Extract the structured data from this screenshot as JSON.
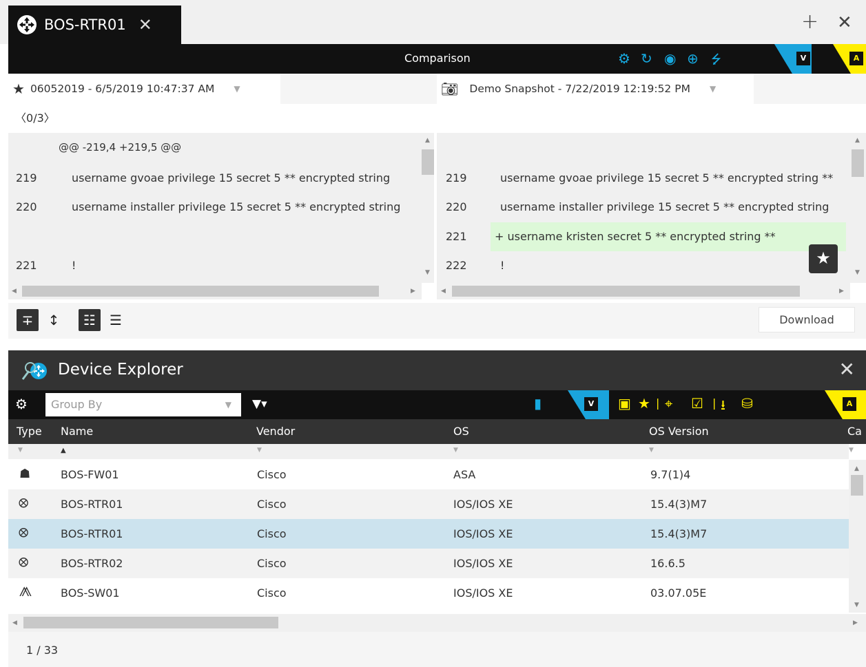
{
  "tab": {
    "title": "BOS-RTR01",
    "close": "✕"
  },
  "window": {
    "add": "+",
    "close": "✕"
  },
  "comparison": {
    "title": "Comparison",
    "left_snapshot": "06052019 - 6/5/2019 10:47:37 AM",
    "right_snapshot": "Demo Snapshot - 7/22/2019 12:19:52 PM",
    "nav": {
      "prev": "〈",
      "counter": "0/3",
      "next": "〉"
    },
    "hunk_header": "@@ -219,4 +219,5 @@",
    "left_lines": [
      {
        "num": "219",
        "text": "username gvoae privilege 15 secret 5 ** encrypted string"
      },
      {
        "num": "220",
        "text": "username installer privilege 15 secret 5 ** encrypted string"
      },
      {
        "num": "",
        "text": ""
      },
      {
        "num": "221",
        "text": "!"
      }
    ],
    "right_lines": [
      {
        "num": "219",
        "text": "username gvoae privilege 15 secret 5 ** encrypted string **"
      },
      {
        "num": "220",
        "text": "username installer privilege 15 secret 5 ** encrypted string"
      },
      {
        "num": "221",
        "text": "+ username kristen secret 5 ** encrypted string **"
      },
      {
        "num": "222",
        "text": "!"
      }
    ],
    "download_label": "Download",
    "mode_v": "V",
    "mode_a": "A"
  },
  "device_explorer": {
    "title": "Device Explorer",
    "close": "✕",
    "group_by_placeholder": "Group By",
    "columns": [
      "Type",
      "Name",
      "Vendor",
      "OS",
      "OS Version",
      "Ca"
    ],
    "rows": [
      {
        "type_icon": "firewall-icon",
        "name": "BOS-FW01",
        "vendor": "Cisco",
        "os": "ASA",
        "os_version": "9.7(1)4"
      },
      {
        "type_icon": "router-icon",
        "name": "BOS-RTR01",
        "vendor": "Cisco",
        "os": "IOS/IOS XE",
        "os_version": "15.4(3)M7"
      },
      {
        "type_icon": "router-icon",
        "name": "BOS-RTR01",
        "vendor": "Cisco",
        "os": "IOS/IOS XE",
        "os_version": "15.4(3)M7"
      },
      {
        "type_icon": "router-icon",
        "name": "BOS-RTR02",
        "vendor": "Cisco",
        "os": "IOS/IOS XE",
        "os_version": "16.6.5"
      },
      {
        "type_icon": "switch-icon",
        "name": "BOS-SW01",
        "vendor": "Cisco",
        "os": "IOS/IOS XE",
        "os_version": "03.07.05E"
      }
    ],
    "selected_row": 2,
    "status": "1 / 33"
  },
  "colors": {
    "accent_blue": "#1aa4dc",
    "accent_yellow": "#ffee00",
    "added_green": "#ddf8d8",
    "selected_row": "#cce3ee"
  }
}
